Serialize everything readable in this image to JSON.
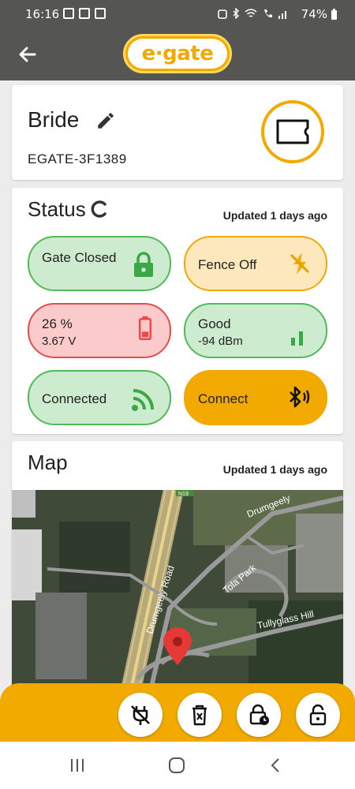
{
  "statusbar": {
    "time": "16:16",
    "battery": "74%"
  },
  "header": {
    "logo_text": "e·gate"
  },
  "device": {
    "name": "Bride",
    "id": "EGATE-3F1389"
  },
  "status": {
    "title": "Status",
    "updated": "Updated 1 days ago",
    "gate": {
      "label": "Gate Closed"
    },
    "fence": {
      "label": "Fence Off"
    },
    "battery": {
      "percent": "26 %",
      "voltage": "3.67 V"
    },
    "signal": {
      "quality": "Good",
      "strength": "-94 dBm"
    },
    "connection": {
      "label": "Connected"
    },
    "bluetooth": {
      "label": "Connect"
    }
  },
  "map": {
    "title": "Map",
    "updated": "Updated 1 days ago",
    "labels": {
      "road1": "Drumgeely Road",
      "road2": "Tola Park",
      "road3": "Tullyglass Hill",
      "road4": "Drumgeely",
      "shield": "N19"
    }
  },
  "colors": {
    "accent": "#f2a900",
    "green": "#52b95a",
    "red": "#e74c4c"
  }
}
